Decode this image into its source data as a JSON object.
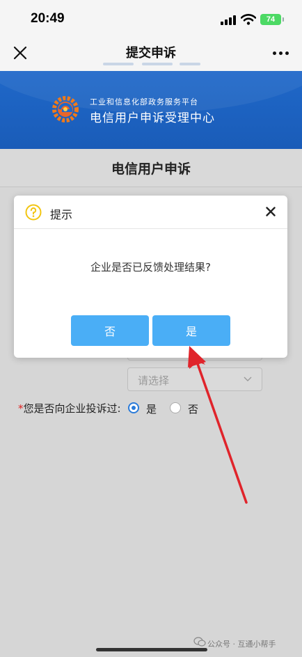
{
  "status_bar": {
    "time": "20:49",
    "battery": "74"
  },
  "nav": {
    "title": "提交申诉"
  },
  "banner": {
    "subtitle": "工业和信息化部政务服务平台",
    "title": "电信用户申诉受理中心"
  },
  "section": {
    "title": "电信用户申诉"
  },
  "form": {
    "select_placeholder": "请选择",
    "question_required_mark": "*",
    "question_label": "您是否向企业投诉过:",
    "option_yes": "是",
    "option_no": "否",
    "selected": "是"
  },
  "dialog": {
    "title": "提示",
    "message": "企业是否已反馈处理结果?",
    "no_label": "否",
    "yes_label": "是"
  },
  "footer": {
    "watermark": "公众号 · 互通小帮手"
  },
  "colors": {
    "brand_blue": "#1f68c9",
    "button_blue": "#4aaef6",
    "arrow_red": "#e0242b",
    "required_red": "#e02020"
  }
}
